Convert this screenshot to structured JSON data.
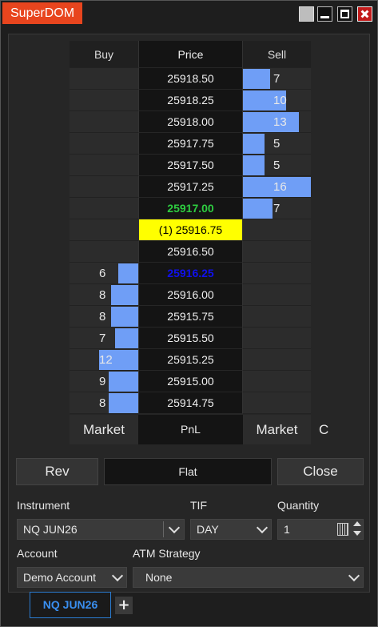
{
  "window": {
    "title": "SuperDOM"
  },
  "ladder": {
    "headers": {
      "buy": "Buy",
      "price": "Price",
      "sell": "Sell"
    },
    "rows": [
      {
        "price": "25918.50",
        "sell": "7",
        "sell_level": 0.4
      },
      {
        "price": "25918.25",
        "sell": "10",
        "sell_level": 0.63
      },
      {
        "price": "25918.00",
        "sell": "13",
        "sell_level": 0.82
      },
      {
        "price": "25917.75",
        "sell": "5",
        "sell_level": 0.32
      },
      {
        "price": "25917.50",
        "sell": "5",
        "sell_level": 0.32
      },
      {
        "price": "25917.25",
        "sell": "16",
        "sell_level": 1.0
      },
      {
        "price": "25917.00",
        "sell": "7",
        "sell_level": 0.44,
        "state": "last"
      },
      {
        "price": "(1) 25916.75",
        "state": "ask"
      },
      {
        "price": "25916.50"
      },
      {
        "price": "25916.25",
        "buy": "6",
        "buy_level": 0.38,
        "state": "bid"
      },
      {
        "price": "25916.00",
        "buy": "8",
        "buy_level": 0.52
      },
      {
        "price": "25915.75",
        "buy": "8",
        "buy_level": 0.52
      },
      {
        "price": "25915.50",
        "buy": "7",
        "buy_level": 0.44
      },
      {
        "price": "25915.25",
        "buy": "12",
        "buy_level": 0.76
      },
      {
        "price": "25915.00",
        "buy": "9",
        "buy_level": 0.57
      },
      {
        "price": "25914.75",
        "buy": "8",
        "buy_level": 0.57
      }
    ],
    "footer": {
      "buy_market": "Market",
      "pnl": "PnL",
      "sell_market": "Market",
      "c_label": "C"
    }
  },
  "actions": {
    "rev": "Rev",
    "position": "Flat",
    "close": "Close"
  },
  "form": {
    "instrument_label": "Instrument",
    "instrument_value": "NQ JUN26",
    "tif_label": "TIF",
    "tif_value": "DAY",
    "quantity_label": "Quantity",
    "quantity_value": "1",
    "account_label": "Account",
    "account_value": "Demo Account",
    "atm_label": "ATM Strategy",
    "atm_value": "None"
  },
  "tabs": [
    {
      "label": "NQ JUN26"
    }
  ],
  "add_tab": "+",
  "colors": {
    "title_bg": "#e8451e",
    "bar": "#6f9ef6",
    "last": "#2ecc40",
    "ask": "#ffff00",
    "bid": "#1010ee",
    "tab": "#2a7bd0"
  }
}
